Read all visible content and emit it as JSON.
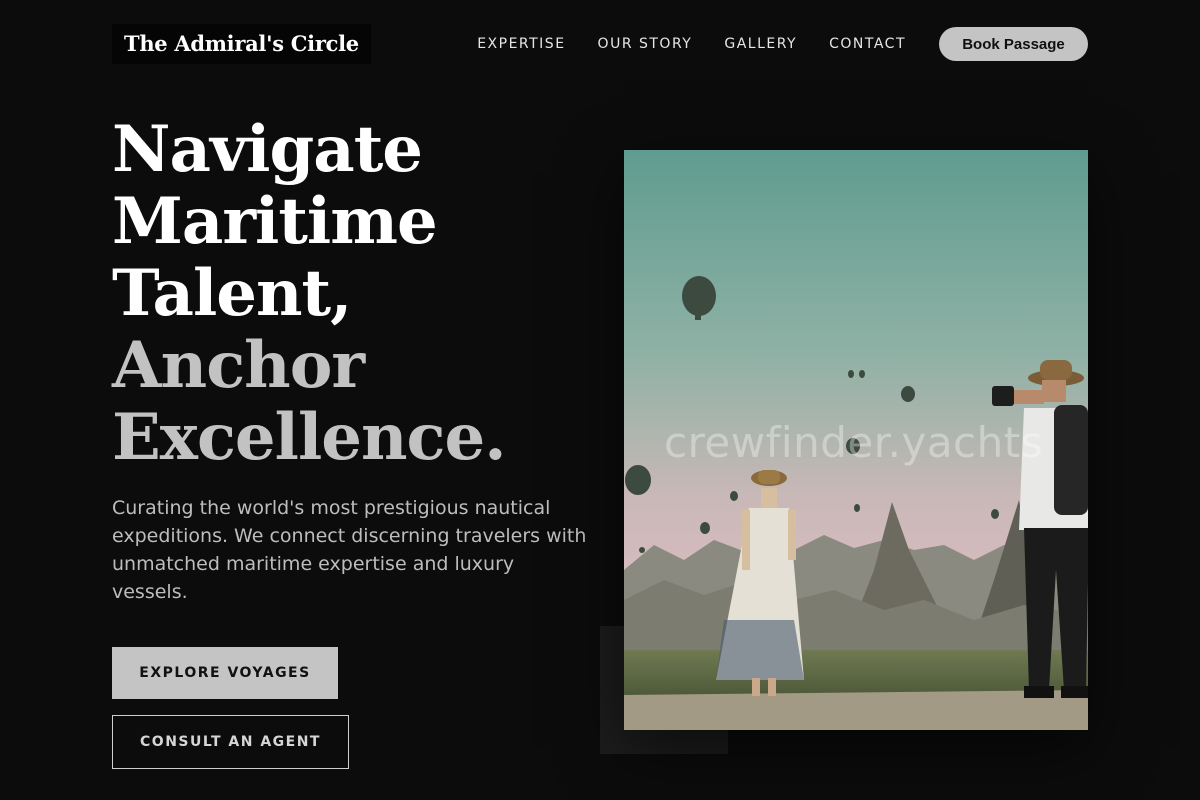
{
  "brand": {
    "name": "The Admiral's Circle"
  },
  "nav": {
    "items": [
      "EXPERTISE",
      "OUR STORY",
      "GALLERY",
      "CONTACT"
    ],
    "cta_label": "Book Passage"
  },
  "hero": {
    "title_white": [
      "Navigate",
      "Maritime",
      "Talent,"
    ],
    "title_grey": [
      "Anchor",
      "Excellence."
    ],
    "subtitle": "Curating the world's most prestigious nautical expeditions. We connect discerning travelers with unmatched maritime expertise and luxury vessels.",
    "primary_button": "EXPLORE VOYAGES",
    "secondary_button": "CONSULT AN AGENT"
  },
  "image": {
    "watermark": "crewfinder.yachts",
    "subject": "couple watching hot air balloons over rocky valley"
  },
  "colors": {
    "background": "#0c0c0c",
    "button_primary": "#c4c4c4",
    "text_grey": "#c2c2c2"
  }
}
